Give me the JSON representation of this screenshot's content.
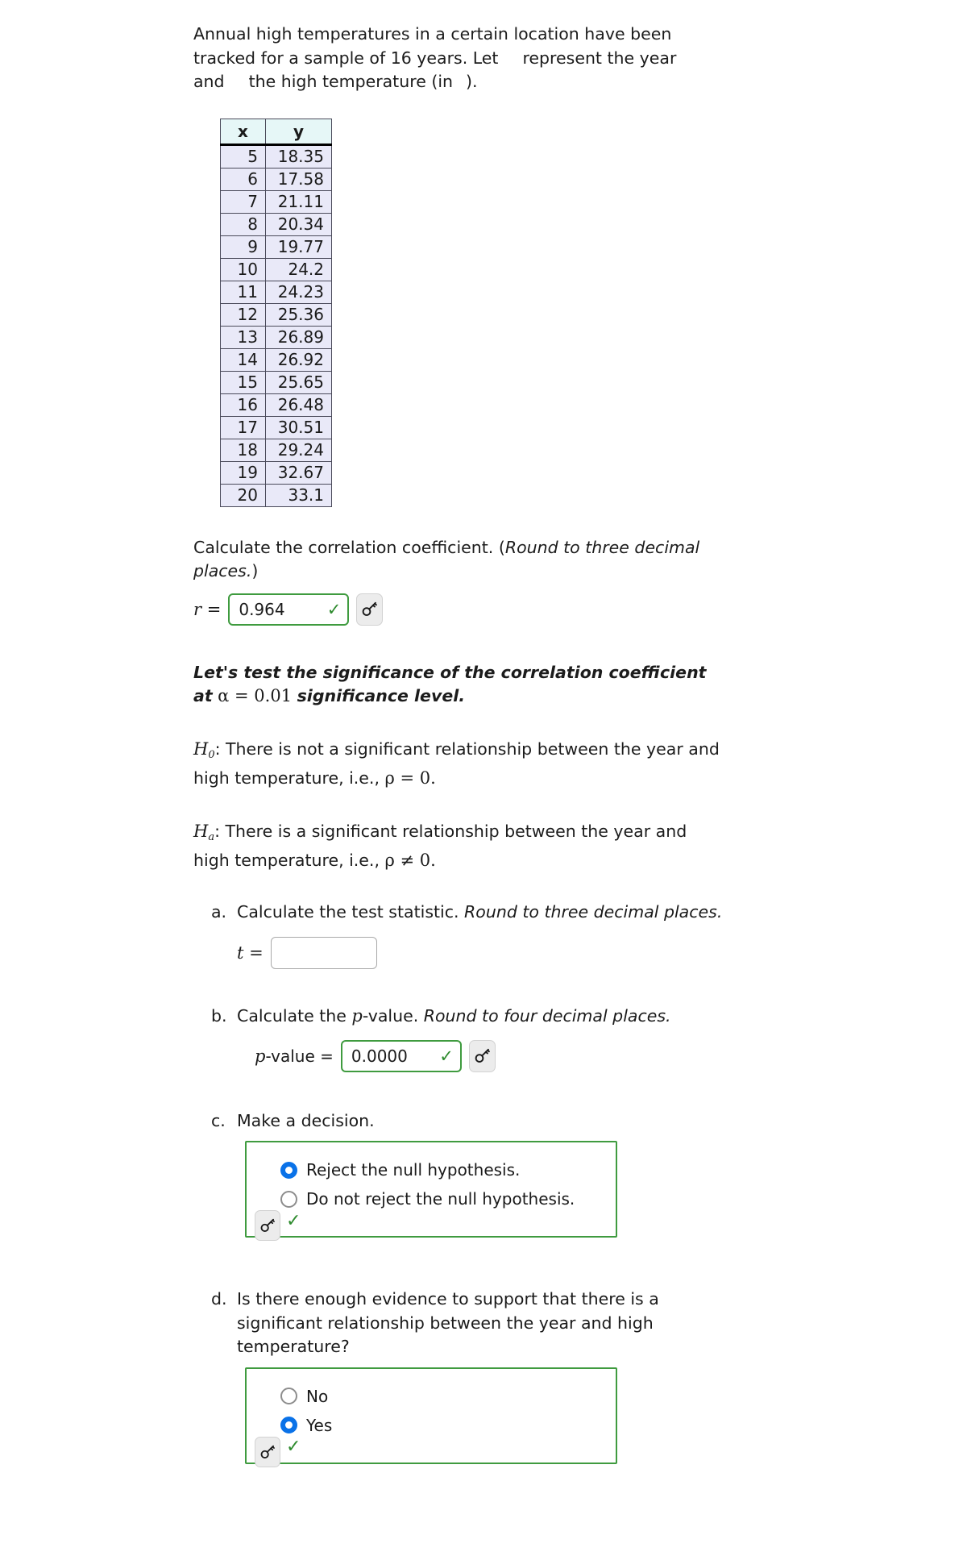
{
  "intro": {
    "line1": "Annual high temperatures in a certain location have been",
    "line2a": "tracked for a sample of 16 years. Let",
    "line2b": "represent the year",
    "line3a": "and",
    "line3b": "the high temperature (in",
    "line3c": ")."
  },
  "table": {
    "headers": [
      "x",
      "y"
    ],
    "rows": [
      [
        "5",
        "18.35"
      ],
      [
        "6",
        "17.58"
      ],
      [
        "7",
        "21.11"
      ],
      [
        "8",
        "20.34"
      ],
      [
        "9",
        "19.77"
      ],
      [
        "10",
        "24.2"
      ],
      [
        "11",
        "24.23"
      ],
      [
        "12",
        "25.36"
      ],
      [
        "13",
        "26.89"
      ],
      [
        "14",
        "26.92"
      ],
      [
        "15",
        "25.65"
      ],
      [
        "16",
        "26.48"
      ],
      [
        "17",
        "30.51"
      ],
      [
        "18",
        "29.24"
      ],
      [
        "19",
        "32.67"
      ],
      [
        "20",
        "33.1"
      ]
    ]
  },
  "correlation": {
    "prompt_plain": "Calculate the correlation coefficient. (",
    "prompt_italic": "Round to three decimal places.",
    "prompt_close": ")",
    "label": "r =",
    "value": "0.964",
    "check": "✓",
    "key_icon": "key-icon"
  },
  "significance": {
    "line1": "Let's test the significance of the correlation coefficient",
    "line2_prefix": "at",
    "alpha": "α = 0.01",
    "line2_suffix": "significance level.",
    "h0": {
      "symbol": "H",
      "sub": "0",
      "text_before": ": There is not a significant relationship between the year and high temperature, i.e., ",
      "math": "ρ = 0."
    },
    "ha": {
      "symbol": "H",
      "sub": "a",
      "text_before": ": There is a significant relationship between the year and high temperature, i.e., ",
      "math": "ρ ≠ 0."
    }
  },
  "questions": [
    {
      "marker": "a.",
      "text_plain": "Calculate the test statistic. ",
      "text_italic": "Round to three decimal places.",
      "answer_label": "t =",
      "answer_value": "",
      "answered": false
    },
    {
      "marker": "b.",
      "text_plain_1": "Calculate the ",
      "text_math": "p",
      "text_plain_2": "-value. ",
      "text_italic": "Round to four decimal places.",
      "answer_label_math": "p",
      "answer_label_rest": "-value =",
      "answer_value": "0.0000",
      "answered": true,
      "check": "✓",
      "key_icon": "key-icon"
    },
    {
      "marker": "c.",
      "text_plain": "Make a decision.",
      "options": [
        {
          "label": "Reject the null hypothesis.",
          "selected": true
        },
        {
          "label": "Do not reject the null hypothesis.",
          "selected": false
        }
      ],
      "check": "✓",
      "key_icon": "key-icon"
    },
    {
      "marker": "d.",
      "text_plain": "Is there enough evidence to support that there is a significant relationship between the year and high temperature?",
      "options": [
        {
          "label": "No",
          "selected": false
        },
        {
          "label": "Yes",
          "selected": true
        }
      ],
      "check": "✓",
      "key_icon": "key-icon"
    }
  ],
  "colors": {
    "accent_green": "#3f9b3f",
    "radio_blue": "#0a72e8",
    "check_green": "#2e8b2e",
    "table_header_bg": "#e6f7f7",
    "table_cell_bg": "#e9e9f8"
  }
}
